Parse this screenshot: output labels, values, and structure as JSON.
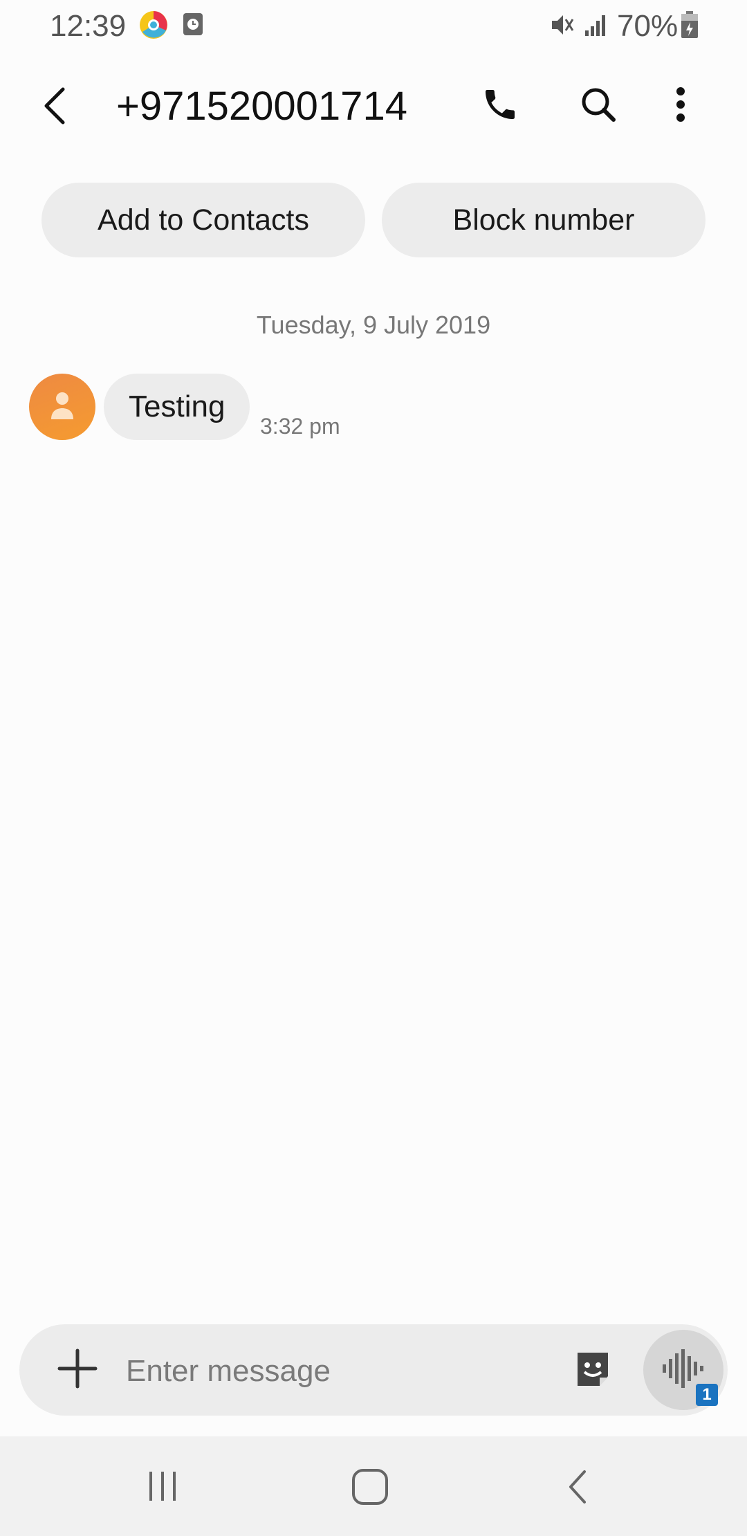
{
  "status_bar": {
    "time": "12:39",
    "battery_percent": "70%",
    "icons": [
      "chrome-like-app-icon",
      "clock-notification-icon",
      "mute-icon",
      "signal-icon",
      "battery-charging-icon"
    ]
  },
  "header": {
    "title": "+971520001714",
    "icons": [
      "back-arrow-icon",
      "phone-icon",
      "search-icon",
      "more-vertical-icon"
    ]
  },
  "actions": {
    "add_to_contacts": "Add to Contacts",
    "block_number": "Block number"
  },
  "conversation": {
    "date_label": "Tuesday, 9 July 2019",
    "messages": [
      {
        "text": "Testing",
        "time": "3:32 pm",
        "direction": "incoming"
      }
    ]
  },
  "composer": {
    "placeholder": "Enter message",
    "sim_badge": "1",
    "icons": [
      "plus-icon",
      "sticker-icon",
      "voice-wave-icon"
    ]
  },
  "colors": {
    "avatar": "#f28f3b",
    "bubble": "#ececec",
    "sim_badge": "#1a73c0"
  }
}
